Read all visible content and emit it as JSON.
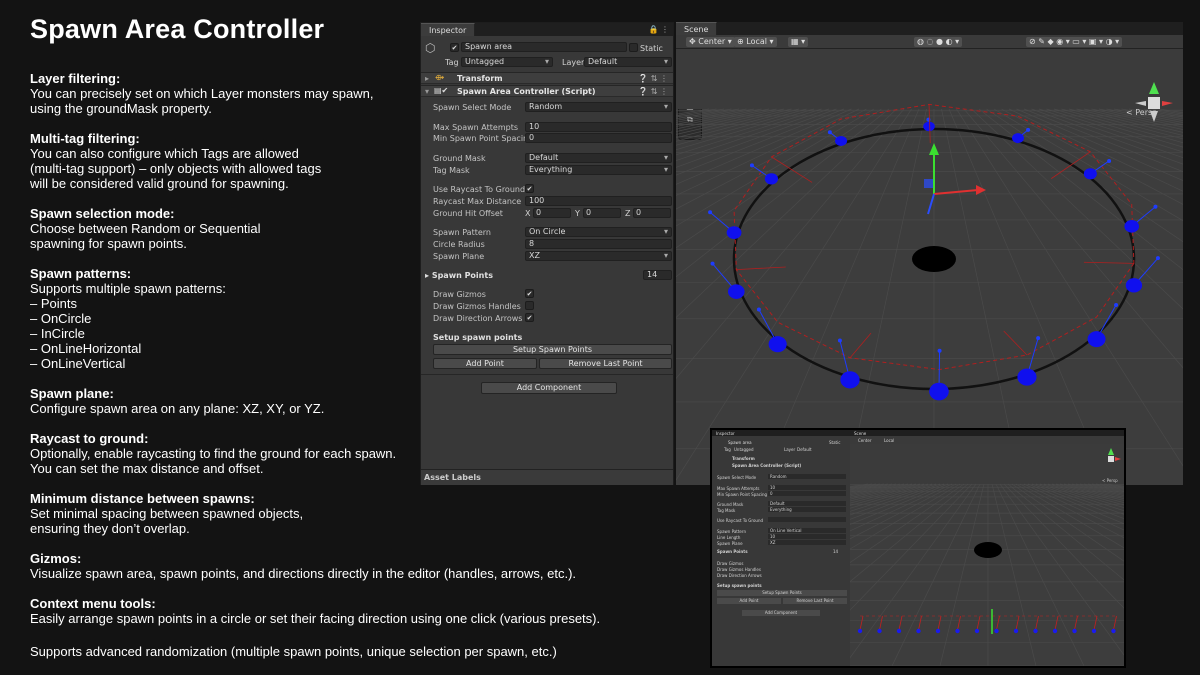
{
  "page": {
    "title": "Spawn Area Controller"
  },
  "features": [
    {
      "heading": "Layer filtering:",
      "lines": [
        "You can precisely set on which Layer monsters may spawn,",
        "using the groundMask property."
      ]
    },
    {
      "heading": "Multi-tag filtering:",
      "lines": [
        "You can also configure which Tags are allowed",
        " (multi-tag support) – only objects with allowed tags",
        " will be considered valid ground for spawning."
      ]
    },
    {
      "heading": "Spawn selection mode:",
      "lines": [
        "Choose between Random or Sequential",
        "spawning for spawn points."
      ]
    },
    {
      "heading": "Spawn patterns:",
      "lines": [
        "Supports multiple spawn patterns:",
        "– Points",
        "– OnCircle",
        "– InCircle",
        "– OnLineHorizontal",
        "– OnLineVertical"
      ]
    },
    {
      "heading": "Spawn plane:",
      "lines": [
        "Configure spawn area on any plane: XZ, XY, or YZ."
      ]
    },
    {
      "heading": "Raycast to ground:",
      "lines": [
        "Optionally, enable raycasting to find the ground for each spawn.",
        "You can set the max distance and offset."
      ]
    },
    {
      "heading": "Minimum distance between spawns:",
      "lines": [
        "Set minimal spacing between spawned objects,",
        "ensuring they don’t overlap."
      ]
    },
    {
      "heading": "Gizmos:",
      "lines": [
        "Visualize spawn area, spawn points, and directions directly in the editor (handles, arrows, etc.)."
      ]
    },
    {
      "heading": "Context menu tools:",
      "lines": [
        "Easily arrange spawn points in a circle or set their facing direction using one click (various presets)."
      ]
    },
    {
      "heading": "",
      "lines": [
        "Supports advanced randomization (multiple spawn points, unique selection per spawn, etc.)"
      ]
    }
  ],
  "inspector": {
    "tab": "Inspector",
    "object_name": "Spawn area",
    "static_label": "Static",
    "tag_label": "Tag",
    "tag_value": "Untagged",
    "layer_label": "Layer",
    "layer_value": "Default",
    "transform": "Transform",
    "component": "Spawn Area Controller (Script)",
    "spawn_select_mode": {
      "label": "Spawn Select Mode",
      "value": "Random"
    },
    "max_spawn_attempts": {
      "label": "Max Spawn Attempts",
      "value": "10"
    },
    "min_spawn_spacing": {
      "label": "Min Spawn Point Spacing",
      "value": "0"
    },
    "ground_mask": {
      "label": "Ground Mask",
      "value": "Default"
    },
    "tag_mask": {
      "label": "Tag Mask",
      "value": "Everything"
    },
    "use_raycast": {
      "label": "Use Raycast To Ground",
      "checked": "✔"
    },
    "raycast_max": {
      "label": "Raycast Max Distance",
      "value": "100"
    },
    "ground_hit": {
      "label": "Ground Hit Offset",
      "x": "X",
      "xv": "0",
      "y": "Y",
      "yv": "0",
      "z": "Z",
      "zv": "0"
    },
    "spawn_pattern": {
      "label": "Spawn Pattern",
      "value": "On Circle"
    },
    "circle_radius": {
      "label": "Circle Radius",
      "value": "8"
    },
    "spawn_plane": {
      "label": "Spawn Plane",
      "value": "XZ"
    },
    "spawn_points": {
      "label": "Spawn Points",
      "value": "14"
    },
    "draw_gizmos": {
      "label": "Draw Gizmos",
      "checked": "✔"
    },
    "draw_handles": {
      "label": "Draw Gizmos Handles",
      "checked": ""
    },
    "draw_arrows": {
      "label": "Draw Direction Arrows",
      "checked": "✔"
    },
    "setup_heading": "Setup spawn points",
    "setup_button": "Setup Spawn Points",
    "add_point": "Add Point",
    "remove_last": "Remove Last Point",
    "add_component": "Add Component",
    "asset_labels": "Asset Labels"
  },
  "scene": {
    "tab": "Scene",
    "center": "Center",
    "local": "Local",
    "persp": "< Persp"
  },
  "mini": {
    "inspector_tab": "Inspector",
    "scene_tab": "Scene",
    "object_name": "Spawn area",
    "static_label": "Static",
    "tag_label": "Tag",
    "tag_value": "Untagged",
    "layer_label": "Layer",
    "layer_value": "Default",
    "transform": "Transform",
    "component": "Spawn Area Controller (Script)",
    "rows": [
      {
        "label": "Spawn Select Mode",
        "value": "Random"
      },
      {
        "label": "Max Spawn Attempts",
        "value": "10"
      },
      {
        "label": "Min Spawn Point Spacing",
        "value": "0"
      },
      {
        "label": "Ground Mask",
        "value": "Default"
      },
      {
        "label": "Tag Mask",
        "value": "Everything"
      },
      {
        "label": "Use Raycast To Ground",
        "value": ""
      },
      {
        "label": "Spawn Pattern",
        "value": "On Line Vertical"
      },
      {
        "label": "Line Length",
        "value": "10"
      },
      {
        "label": "Spawn Plane",
        "value": "XZ"
      }
    ],
    "spawn_points": "Spawn Points",
    "spawn_count": "14",
    "draw_gizmos": "Draw Gizmos",
    "draw_handles": "Draw Gizmos Handles",
    "draw_arrows": "Draw Direction Arrows",
    "setup_heading": "Setup spawn points",
    "setup_button": "Setup Spawn Points",
    "add_point": "Add Point",
    "remove_last": "Remove Last Point",
    "add_component": "Add Component",
    "center": "Center",
    "local": "Local",
    "persp": "< Persp"
  }
}
